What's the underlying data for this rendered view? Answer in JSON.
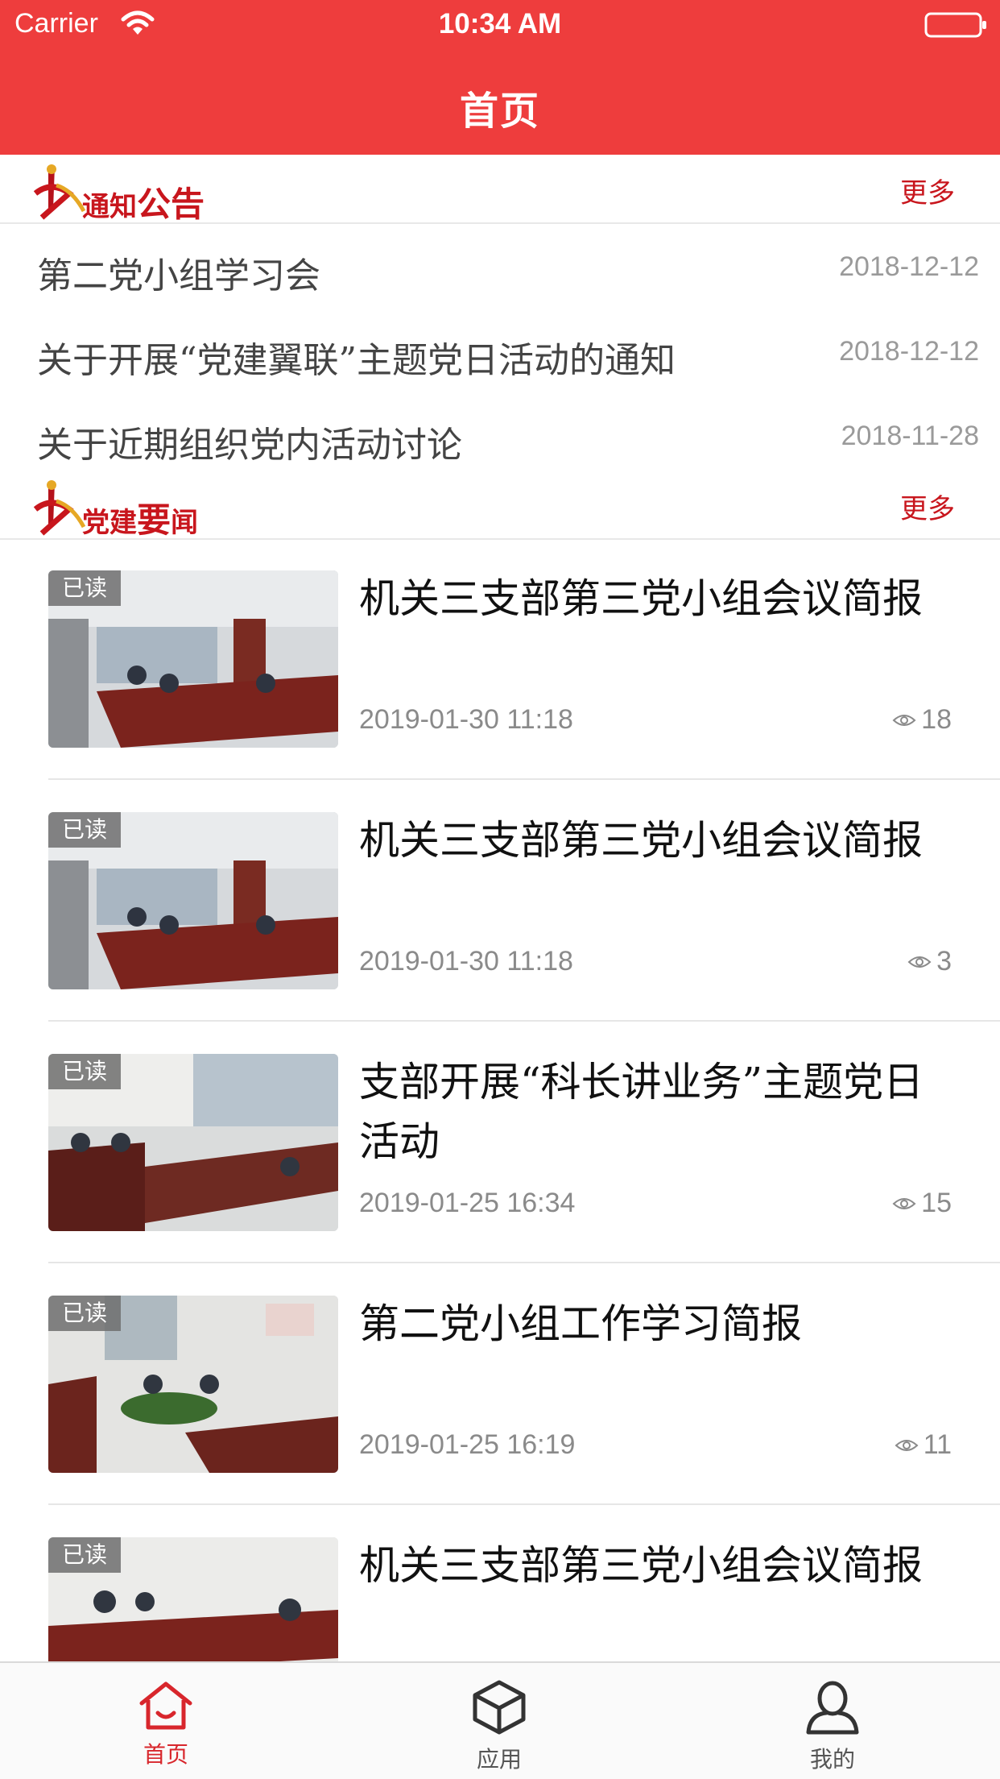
{
  "status_bar": {
    "carrier": "Carrier",
    "time": "10:34 AM"
  },
  "header": {
    "title": "首页"
  },
  "colors": {
    "brand_red": "#ee3d3d",
    "accent_red": "#c8161d"
  },
  "notices": {
    "logo_text": {
      "part1": "通知",
      "part2": "公告"
    },
    "more_label": "更多",
    "items": [
      {
        "title": "第二党小组学习会",
        "date": "2018-12-12"
      },
      {
        "title": "关于开展“党建翼联”主题党日活动的通知",
        "date": "2018-12-12"
      },
      {
        "title": "关于近期组织党内活动讨论",
        "date": "2018-11-28"
      }
    ]
  },
  "news": {
    "logo_text": {
      "part1": "党建",
      "part2": "要",
      "part3": "闻"
    },
    "more_label": "更多",
    "items": [
      {
        "badge": "已读",
        "title": "机关三支部第三党小组会议简报",
        "date": "2019-01-30 11:18",
        "views": "18"
      },
      {
        "badge": "已读",
        "title": "机关三支部第三党小组会议简报",
        "date": "2019-01-30 11:18",
        "views": "3"
      },
      {
        "badge": "已读",
        "title": "支部开展“科长讲业务”主题党日活动",
        "date": "2019-01-25 16:34",
        "views": "15"
      },
      {
        "badge": "已读",
        "title": "第二党小组工作学习简报",
        "date": "2019-01-25 16:19",
        "views": "11"
      },
      {
        "badge": "已读",
        "title": "机关三支部第三党小组会议简报",
        "date": "",
        "views": ""
      }
    ]
  },
  "tab_bar": {
    "tabs": [
      {
        "label": "首页",
        "icon": "home-icon",
        "active": true
      },
      {
        "label": "应用",
        "icon": "cube-icon",
        "active": false
      },
      {
        "label": "我的",
        "icon": "person-icon",
        "active": false
      }
    ]
  }
}
